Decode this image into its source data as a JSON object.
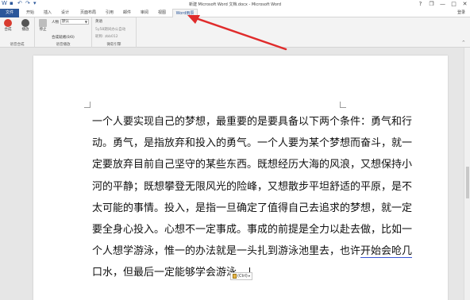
{
  "titlebar": {
    "title": "新建 Microsoft Word 文档.docx - Microsoft Word",
    "qat_icons": [
      "word-logo-icon",
      "save-icon",
      "undo-icon",
      "redo-icon",
      "customize-icon"
    ],
    "controls": {
      "help": "?",
      "restore": "❐",
      "minimize": "—",
      "maximize": "□",
      "close": "✕"
    }
  },
  "tabs": {
    "file": "文件",
    "items": [
      "开始",
      "插入",
      "设计",
      "页面布局",
      "引用",
      "邮件",
      "审阅",
      "视图",
      "Word雨辰"
    ],
    "active_index": 8,
    "signin": "登录"
  },
  "ribbon": {
    "groups": [
      {
        "label": "语音合成"
      },
      {
        "label": "语音播放"
      },
      {
        "label": "微软引擎"
      }
    ],
    "synth": {
      "record_label": "合成",
      "play_label": "播放",
      "stop_label": "停止"
    },
    "playback": {
      "person_label": "人物",
      "person_value": "默认",
      "synth_info": "合成就绪(0/0)"
    },
    "engine": {
      "lang_label": "英语",
      "line1": "5y58期间办公自动",
      "line2": "昵称: zbb012"
    },
    "collapse": "^"
  },
  "document": {
    "lines": [
      "一个人要实现自己的梦想，最重要的是要具备以下两个条件：勇气和行",
      "动。勇气，是指放弃和投入的勇气。一个人要为某个梦想而奋斗，就一",
      "定要放弃目前自己坚守的某些东西。既想经历大海的风浪，又想保持小",
      "河的平静；既想攀登无限风光的险峰，又想散步平坦舒适的平原，是不",
      "太可能的事情。投入，是指一旦确定了值得自己去追求的梦想，就一定",
      "要全身心投入。心想不一定事成。事成的前提是全力以赴去做，比如一",
      "个人想学游泳，惟一的办法就是一头扎到游泳池里去，也许"
    ],
    "line7_underlined": "开始会呛几",
    "line8": "口水，但最后一定能够学会游泳。"
  },
  "paste_badge": "(Ctrl)",
  "colors": {
    "accent": "#2b579a",
    "arrow": "#e02b2b"
  }
}
